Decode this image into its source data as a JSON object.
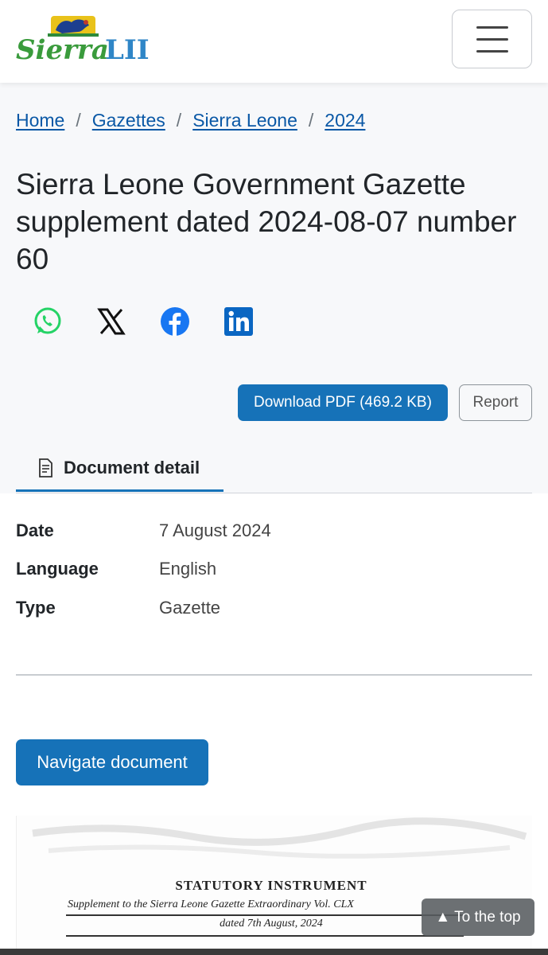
{
  "brand": {
    "logo_text": "SierraLII"
  },
  "menu": {
    "icon": "hamburger-menu-icon"
  },
  "breadcrumb": [
    {
      "label": "Home"
    },
    {
      "label": "Gazettes"
    },
    {
      "label": "Sierra Leone"
    },
    {
      "label": "2024"
    }
  ],
  "breadcrumb_separator": "/",
  "title": "Sierra Leone Government Gazette supplement dated 2024-08-07 number 60",
  "share": [
    {
      "icon": "whatsapp-icon",
      "color": "#25d366"
    },
    {
      "icon": "x-icon",
      "color": "#000000"
    },
    {
      "icon": "facebook-icon",
      "color": "#1877f2"
    },
    {
      "icon": "linkedin-icon",
      "color": "#0a66c2"
    }
  ],
  "actions": {
    "download_label": "Download PDF (469.2 KB)",
    "report_label": "Report"
  },
  "tabs": [
    {
      "label": "Document detail",
      "icon": "document-icon",
      "active": true
    }
  ],
  "details": [
    {
      "label": "Date",
      "value": "7 August 2024"
    },
    {
      "label": "Language",
      "value": "English"
    },
    {
      "label": "Type",
      "value": "Gazette"
    }
  ],
  "navigate_label": "Navigate document",
  "preview": {
    "heading": "STATUTORY INSTRUMENT",
    "subheading": "Supplement to the Sierra Leone Gazette Extraordinary Vol. CLX",
    "date_line": "dated 7th August, 2024"
  },
  "to_top_label": "▲ To the top",
  "colors": {
    "primary": "#1672b8",
    "link": "#0a58a6"
  }
}
